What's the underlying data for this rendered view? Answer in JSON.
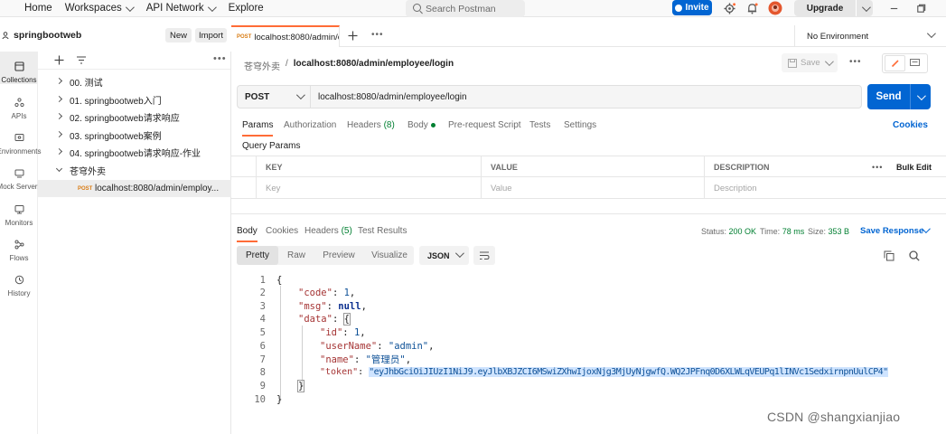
{
  "topbar": {
    "nav": [
      "Home",
      "Workspaces",
      "API Network",
      "Explore"
    ],
    "search_placeholder": "Search Postman",
    "invite_label": "Invite",
    "upgrade_label": "Upgrade"
  },
  "workspace": {
    "name": "springbootweb",
    "new_label": "New",
    "import_label": "Import"
  },
  "rail": [
    "Collections",
    "APIs",
    "Environments",
    "Mock Servers",
    "Monitors",
    "Flows",
    "History"
  ],
  "collections": [
    {
      "label": "00. 测试",
      "open": false
    },
    {
      "label": "01. springbootweb入门",
      "open": false
    },
    {
      "label": "02. springbootweb请求响应",
      "open": false
    },
    {
      "label": "03. springbootweb案例",
      "open": false
    },
    {
      "label": "04. springbootweb请求响应-作业",
      "open": false
    },
    {
      "label": "苍穹外卖",
      "open": true
    }
  ],
  "collection_request": {
    "method": "POST",
    "label": "localhost:8080/admin/employ..."
  },
  "tab": {
    "method": "POST",
    "label": "localhost:8080/admin/e"
  },
  "environment": "No Environment",
  "breadcrumb": {
    "parent": "苍穹外卖",
    "sep": "/",
    "current": "localhost:8080/admin/employee/login"
  },
  "save_label": "Save",
  "request": {
    "method": "POST",
    "url": "localhost:8080/admin/employee/login",
    "send_label": "Send"
  },
  "request_tabs": {
    "params": "Params",
    "authorization": "Authorization",
    "headers": "Headers",
    "headers_count": "(8)",
    "body": "Body",
    "prerequest": "Pre-request Script",
    "tests": "Tests",
    "settings": "Settings",
    "cookies": "Cookies"
  },
  "query_params": {
    "title": "Query Params",
    "headers": [
      "KEY",
      "VALUE",
      "DESCRIPTION"
    ],
    "bulk_edit": "Bulk Edit",
    "placeholders": [
      "Key",
      "Value",
      "Description"
    ]
  },
  "response": {
    "tabs": {
      "body": "Body",
      "cookies": "Cookies",
      "headers": "Headers",
      "headers_count": "(5)",
      "tests": "Test Results"
    },
    "status_label": "Status:",
    "status_value": "200 OK",
    "time_label": "Time:",
    "time_value": "78 ms",
    "size_label": "Size:",
    "size_value": "353 B",
    "save_label": "Save Response",
    "view_tabs": [
      "Pretty",
      "Raw",
      "Preview",
      "Visualize"
    ],
    "format": "JSON"
  },
  "code": {
    "line_numbers": [
      "1",
      "2",
      "3",
      "4",
      "5",
      "6",
      "7",
      "8",
      "9",
      "10"
    ],
    "code_key": "\"code\"",
    "code_val": "1",
    "msg_key": "\"msg\"",
    "msg_val": "null",
    "data_key": "\"data\"",
    "id_key": "\"id\"",
    "id_val": "1",
    "username_key": "\"userName\"",
    "username_val": "\"admin\"",
    "name_key": "\"name\"",
    "name_val": "\"管理员\"",
    "token_key": "\"token\"",
    "token_val": "\"eyJhbGciOiJIUzI1NiJ9.eyJlbXBJZCI6MSwiZXhwIjoxNjg3MjUyNjgwfQ.WQ2JPFnq0D6XLWLqVEUPq1lINVc1SedxirnpnUulCP4\""
  },
  "watermark": "CSDN @shangxianjiao",
  "colors": {
    "accent": "#ff6c37",
    "primary": "#0265d2",
    "status_ok": "#007f31"
  }
}
